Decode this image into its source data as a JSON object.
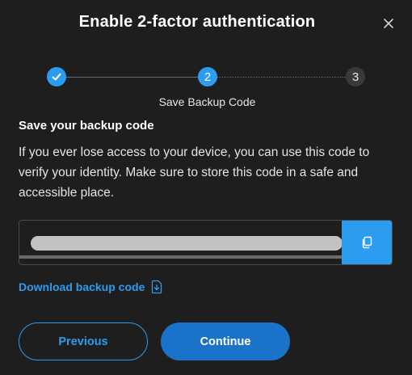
{
  "dialog": {
    "title": "Enable 2-factor authentication",
    "close_icon": "close-icon"
  },
  "stepper": {
    "steps": [
      {
        "label": "1",
        "state": "completed",
        "icon": "check-icon"
      },
      {
        "label": "2",
        "state": "active"
      },
      {
        "label": "3",
        "state": "pending"
      }
    ],
    "current_caption": "Save Backup Code"
  },
  "content": {
    "heading": "Save your backup code",
    "description": "If you ever lose access to your device, you can use this code to verify your identity. Make sure to store this code in a safe and accessible place.",
    "backup_code": {
      "value": "",
      "masked": true,
      "copy_icon": "copy-icon"
    },
    "download_link": {
      "label": "Download backup code",
      "icon": "download-icon"
    }
  },
  "actions": {
    "previous_label": "Previous",
    "continue_label": "Continue"
  },
  "colors": {
    "accent": "#2c9cf0",
    "primary_button": "#1a73c8",
    "background": "#1e1e1e"
  }
}
